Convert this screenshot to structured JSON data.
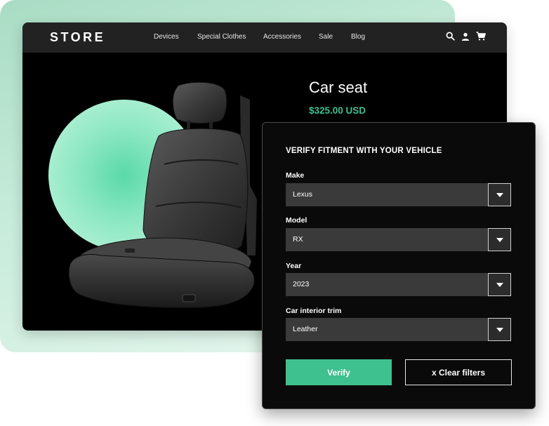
{
  "header": {
    "brand": "STORE",
    "nav": [
      "Devices",
      "Special Clothes",
      "Accessories",
      "Sale",
      "Blog"
    ],
    "icons": [
      "search-icon",
      "user-icon",
      "cart-icon"
    ]
  },
  "product": {
    "title": "Car seat",
    "price": "$325.00 USD"
  },
  "fitment": {
    "heading": "VERIFY FITMENT WITH YOUR VEHICLE",
    "fields": [
      {
        "label": "Make",
        "value": "Lexus"
      },
      {
        "label": "Model",
        "value": "RX"
      },
      {
        "label": "Year",
        "value": "2023"
      },
      {
        "label": "Car interior trim",
        "value": "Leather"
      }
    ],
    "verify_label": "Verify",
    "clear_label": "x Clear filters"
  },
  "colors": {
    "accent": "#3fc08f",
    "window_bg": "#000000",
    "topbar_bg": "#222222",
    "select_bg": "#3a3a3a",
    "background_mint": "#c8ecdb"
  }
}
